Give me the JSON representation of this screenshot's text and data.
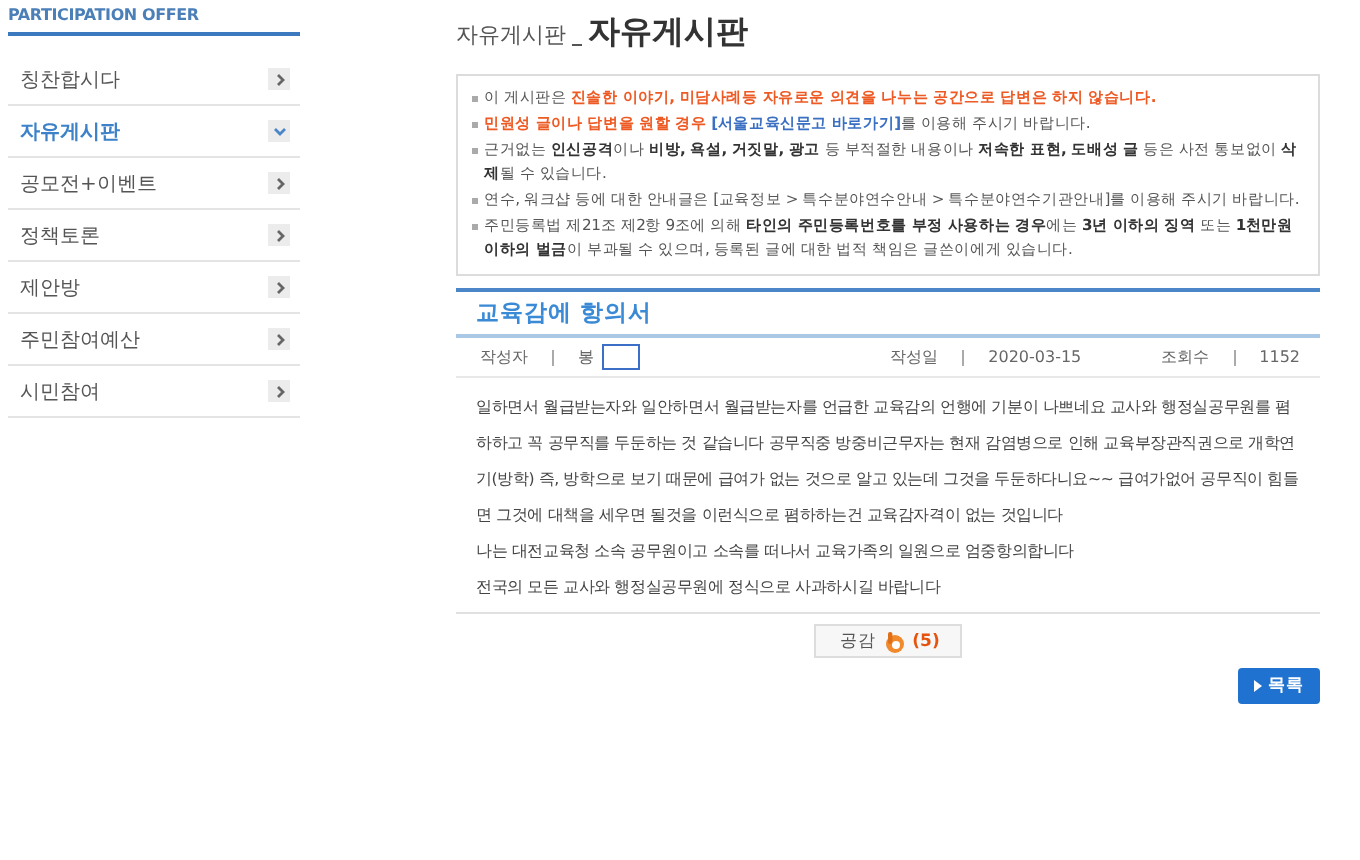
{
  "sidebar": {
    "heading": "PARTICIPATION OFFER",
    "items": [
      {
        "label": "칭찬합시다",
        "selected": false
      },
      {
        "label": "자유게시판",
        "selected": true
      },
      {
        "label": "공모전+이벤트",
        "selected": false
      },
      {
        "label": "정책토론",
        "selected": false
      },
      {
        "label": "제안방",
        "selected": false
      },
      {
        "label": "주민참여예산",
        "selected": false
      },
      {
        "label": "시민참여",
        "selected": false
      }
    ]
  },
  "page_title": {
    "prefix": "자유게시판",
    "title": "자유게시판"
  },
  "notice": [
    [
      {
        "kind": "plain",
        "text": "이 게시판은 "
      },
      {
        "kind": "warn",
        "text": "진솔한 이야기, 미담사례등 자유로운 의견을 나누는 공간으로 답변은 하지 않습니다."
      }
    ],
    [
      {
        "kind": "warn",
        "text": "민원성 글이나 답변을 원할 경우 "
      },
      {
        "kind": "link",
        "text": "[서울교육신문고 바로가기]"
      },
      {
        "kind": "plain",
        "text": "를 이용해 주시기 바랍니다."
      }
    ],
    [
      {
        "kind": "plain",
        "text": "근거없는 "
      },
      {
        "kind": "bold",
        "text": "인신공격"
      },
      {
        "kind": "plain",
        "text": "이나 "
      },
      {
        "kind": "bold",
        "text": "비방, 욕설, 거짓말, 광고"
      },
      {
        "kind": "plain",
        "text": " 등 부적절한 내용이나 "
      },
      {
        "kind": "bold",
        "text": "저속한 표현, 도배성 글"
      },
      {
        "kind": "plain",
        "text": " 등은 사전 통보없이 "
      },
      {
        "kind": "bold",
        "text": "삭제"
      },
      {
        "kind": "plain",
        "text": "될 수 있습니다."
      }
    ],
    [
      {
        "kind": "plain",
        "text": "연수, 워크샵 등에 대한 안내글은 [교육정보 > 특수분야연수안내 > 특수분야연수기관안내]를 이용해 주시기 바랍니다."
      }
    ],
    [
      {
        "kind": "plain",
        "text": "주민등록법 제21조 제2항 9조에 의해 "
      },
      {
        "kind": "bold",
        "text": "타인의 주민등록번호를 부정 사용하는 경우"
      },
      {
        "kind": "plain",
        "text": "에는 "
      },
      {
        "kind": "bold",
        "text": "3년 이하의 징역"
      },
      {
        "kind": "plain",
        "text": " 또는 "
      },
      {
        "kind": "bold",
        "text": "1천만원 이하의 벌금"
      },
      {
        "kind": "plain",
        "text": "이 부과될 수 있으며, 등록된 글에 대한 법적 책임은 글쓴이에게 있습니다."
      }
    ]
  ],
  "post": {
    "title": "교육감에 항의서",
    "meta": {
      "author_label": "작성자",
      "author": "봉",
      "date_label": "작성일",
      "date": "2020-03-15",
      "views_label": "조회수",
      "views": "1152"
    },
    "body": [
      "일하면서 월급받는자와 일안하면서 월급받는자를 언급한 교육감의 언행에 기분이 나쁘네요 교사와 행정실공무원를 폄하하고 꼭 공무직를 두둔하는 것 같습니다 공무직중 방중비근무자는 현재 감염병으로 인해 교육부장관직권으로 개학연기(방학) 즉, 방학으로 보기 때문에 급여가 없는 것으로 알고 있는데 그것을 두둔하다니요~~ 급여가없어 공무직이 힘들면 그것에 대책을 세우면 될것을 이런식으로 폄하하는건 교육감자격이 없는 것입니다",
      "나는 대전교육청 소속 공무원이고 소속를 떠나서 교육가족의 일원으로 엄중항의합니다",
      "전국의 모든 교사와 행정실공무원에 정식으로 사과하시길 바랍니다"
    ]
  },
  "like_button": {
    "label": "공감",
    "count": "(5)"
  },
  "list_button": {
    "label": "목록"
  }
}
